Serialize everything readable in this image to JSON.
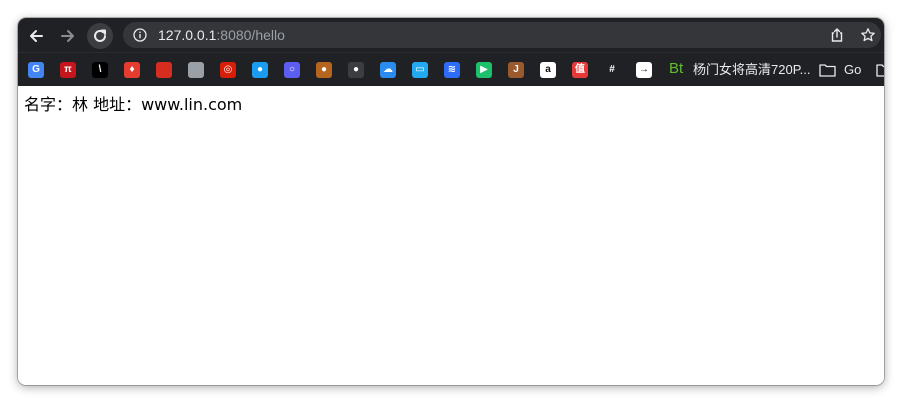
{
  "browser": {
    "url_host": "127.0.0.1",
    "url_rest": ":8080/hello"
  },
  "bookmarks": {
    "items": [
      {
        "icon": "google-translate-icon",
        "color": "#4285f4",
        "glyph": "G"
      },
      {
        "icon": "pi-icon",
        "color": "#c4161c",
        "glyph": "π"
      },
      {
        "icon": "vercel-icon",
        "color": "#000000",
        "glyph": "\\"
      },
      {
        "icon": "mario-icon",
        "color": "#e63c2f",
        "glyph": "♦"
      },
      {
        "icon": "apple-red-icon",
        "color": "#d62d20",
        "glyph": ""
      },
      {
        "icon": "apple-icon",
        "color": "#9aa0a6",
        "glyph": ""
      },
      {
        "icon": "netease-music-icon",
        "color": "#d81e06",
        "glyph": "◎"
      },
      {
        "icon": "location-pin-icon",
        "color": "#1a9cf0",
        "glyph": "●"
      },
      {
        "icon": "circle-app-icon",
        "color": "#5b5ef0",
        "glyph": "○"
      },
      {
        "icon": "acorn-icon",
        "color": "#b5651d",
        "glyph": "●"
      },
      {
        "icon": "github-icon",
        "color": "#3c3d41",
        "glyph": "●"
      },
      {
        "icon": "cloud-icon",
        "color": "#2b8cf0",
        "glyph": "☁"
      },
      {
        "icon": "bilibili-icon",
        "color": "#23a9f2",
        "glyph": "▭"
      },
      {
        "icon": "layers-icon",
        "color": "#2d6cf6",
        "glyph": "≋"
      },
      {
        "icon": "play-icon",
        "color": "#1ec16b",
        "glyph": "▶"
      },
      {
        "icon": "j-icon",
        "color": "#9b5a2e",
        "glyph": "J"
      },
      {
        "icon": "amazon-icon",
        "color": "#ffffff",
        "glyph": "a"
      },
      {
        "icon": "zhi-icon",
        "color": "#e8393a",
        "glyph": "值"
      },
      {
        "icon": "slack-icon",
        "color": "#202124",
        "glyph": "#"
      },
      {
        "icon": "arrow-box-icon",
        "color": "#ffffff",
        "glyph": "→"
      }
    ],
    "bt_label": "Bt",
    "bt_color": "#5fbf2f",
    "video_label": "杨门女将高清720P...",
    "folder_label": "Go"
  },
  "page": {
    "text": "名字：林 地址：www.lin.com"
  }
}
